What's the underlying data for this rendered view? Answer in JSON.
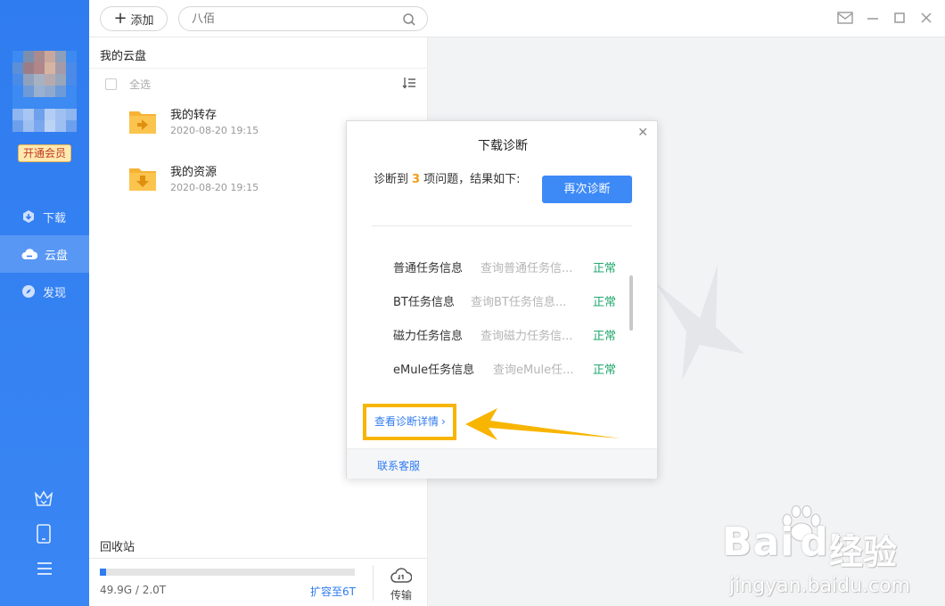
{
  "topbar": {
    "add_label": "添加",
    "search_placeholder": "八佰"
  },
  "sidebar": {
    "vip_label": "开通会员",
    "nav": [
      {
        "label": "下载",
        "icon": "download-icon"
      },
      {
        "label": "云盘",
        "icon": "cloud-icon",
        "active": true
      },
      {
        "label": "发现",
        "icon": "compass-icon"
      }
    ],
    "bottom_icons": [
      "crown-icon",
      "phone-icon",
      "menu-icon"
    ]
  },
  "file_panel": {
    "title": "我的云盘",
    "select_all": "全选",
    "items": [
      {
        "name": "我的转存",
        "date": "2020-08-20 19:15",
        "icon": "folder-transfer-icon"
      },
      {
        "name": "我的资源",
        "date": "2020-08-20 19:15",
        "icon": "folder-download-icon"
      }
    ],
    "recycle": "回收站",
    "storage_used_fraction": 0.025,
    "storage_text": "49.9G / 2.0T",
    "expand_link": "扩容至6T",
    "transfer_label": "传输"
  },
  "dialog": {
    "title": "下载诊断",
    "summary_prefix": "诊断到",
    "issue_count": "3",
    "summary_suffix": "项问题，结果如下:",
    "rediagnose_label": "再次诊断",
    "rows": [
      {
        "name": "普通任务信息",
        "desc": "查询普通任务信...",
        "status": "正常"
      },
      {
        "name": "BT任务信息",
        "desc": "查询BT任务信息...",
        "status": "正常"
      },
      {
        "name": "磁力任务信息",
        "desc": "查询磁力任务信...",
        "status": "正常"
      },
      {
        "name": "eMule任务信息",
        "desc": "查询eMule任...",
        "status": "正常"
      }
    ],
    "detail_link": "查看诊断详情",
    "contact_link": "联系客服"
  },
  "watermark": {
    "brand": "Bai",
    "brand2": "du",
    "brand_cn": "经验",
    "url": "jingyan.baidu.com"
  },
  "colors": {
    "sidebar": "#2f7cf0",
    "primary_button": "#3d8af7",
    "status_ok": "#20a86b",
    "highlight": "#f8b500",
    "issue_count": "#f39c12"
  }
}
